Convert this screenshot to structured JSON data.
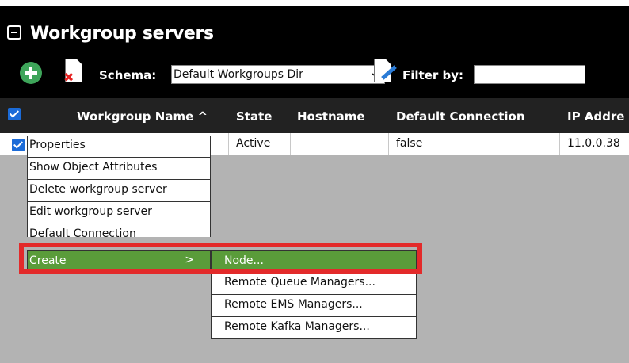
{
  "panel": {
    "title": "Workgroup servers"
  },
  "toolbar": {
    "schema_label": "Schema:",
    "schema_value": "Default Workgroups Dir",
    "filter_label": "Filter by:",
    "filter_value": ""
  },
  "columns": [
    {
      "label": "Workgroup Name ^"
    },
    {
      "label": "State"
    },
    {
      "label": "Hostname"
    },
    {
      "label": "Default Connection"
    },
    {
      "label": "IP Addre"
    }
  ],
  "rows": [
    {
      "selected": true,
      "state": "Active",
      "hostname": "",
      "default_connection": "false",
      "ip": "11.0.0.38"
    }
  ],
  "context_menu": {
    "items": [
      {
        "label": "Properties"
      },
      {
        "label": "Show Object Attributes"
      },
      {
        "label": "Delete workgroup server"
      },
      {
        "label": "Edit workgroup server"
      },
      {
        "label": "Default Connection"
      },
      {
        "label": "Create",
        "arrow": ">",
        "highlighted": true
      }
    ]
  },
  "submenu": {
    "items": [
      {
        "label": "Node...",
        "highlighted": true
      },
      {
        "label": "Remote Queue Managers..."
      },
      {
        "label": "Remote EMS Managers..."
      },
      {
        "label": "Remote Kafka Managers..."
      }
    ]
  },
  "icons": {
    "collapse": "collapse-minus-icon",
    "add": "add-plus-circle-icon",
    "delete": "delete-document-icon",
    "filter": "filter-edit-document-icon"
  },
  "colors": {
    "header_bg": "#000000",
    "column_header_bg": "#222222",
    "menu_highlight": "#5a9c3a",
    "annotation_border": "#e32a2a",
    "checkbox": "#1b6bd8"
  }
}
